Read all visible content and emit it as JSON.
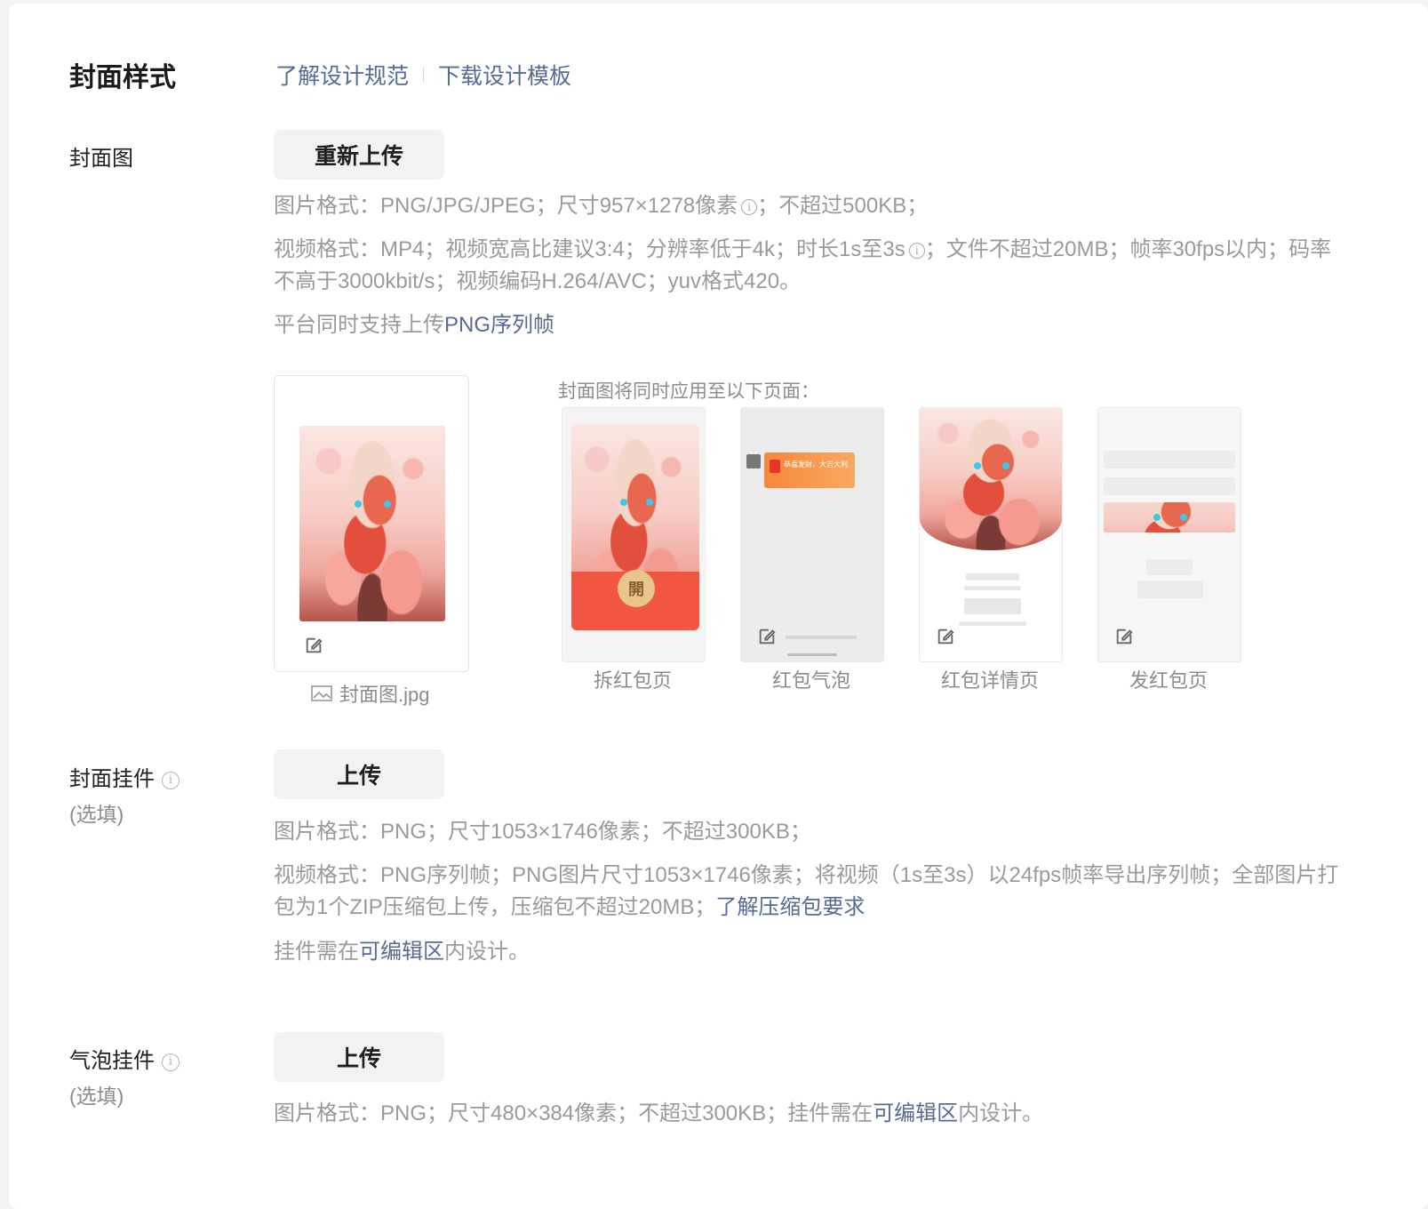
{
  "section": {
    "title": "封面样式",
    "links": [
      "了解设计规范",
      "下载设计模板"
    ]
  },
  "cover": {
    "label": "封面图",
    "button": "重新上传",
    "hint1": "图片格式：PNG/JPG/JPEG；尺寸957×1278像素",
    "hint1_tail": "；不超过500KB；",
    "hint2_a": "视频格式：MP4；视频宽高比建议3:4；分辨率低于4k；时长1s至3s",
    "hint2_b": "；文件不超过20MB；帧率30fps以内；码率不高于3000kbit/s；视频编码H.264/AVC；yuv格式420。",
    "hint3_a": "平台同时支持上传",
    "hint3_link": "PNG序列帧",
    "filename": "封面图.jpg",
    "apply_title": "封面图将同时应用至以下页面：",
    "previews": [
      "拆红包页",
      "红包气泡",
      "红包详情页",
      "发红包页"
    ],
    "open_char": "開",
    "bubble_text": "恭喜发财，大吉大利"
  },
  "pendant": {
    "label": "封面挂件",
    "optional": "(选填)",
    "button": "上传",
    "hint1": "图片格式：PNG；尺寸1053×1746像素；不超过300KB；",
    "hint2_a": "视频格式：PNG序列帧；PNG图片尺寸1053×1746像素；将视频（1s至3s）以24fps帧率导出序列帧；全部图片打包为1个ZIP压缩包上传，压缩包不超过20MB；",
    "hint2_link": "了解压缩包要求",
    "hint3_a": "挂件需在",
    "hint3_link": "可编辑区",
    "hint3_b": "内设计。"
  },
  "bubble_pendant": {
    "label": "气泡挂件",
    "optional": "(选填)",
    "button": "上传",
    "hint_a": "图片格式：PNG；尺寸480×384像素；不超过300KB；挂件需在",
    "hint_link": "可编辑区",
    "hint_b": "内设计。"
  },
  "colors": {
    "link": "#576b95",
    "hint": "#9a9a9a",
    "red": "#f25542"
  }
}
